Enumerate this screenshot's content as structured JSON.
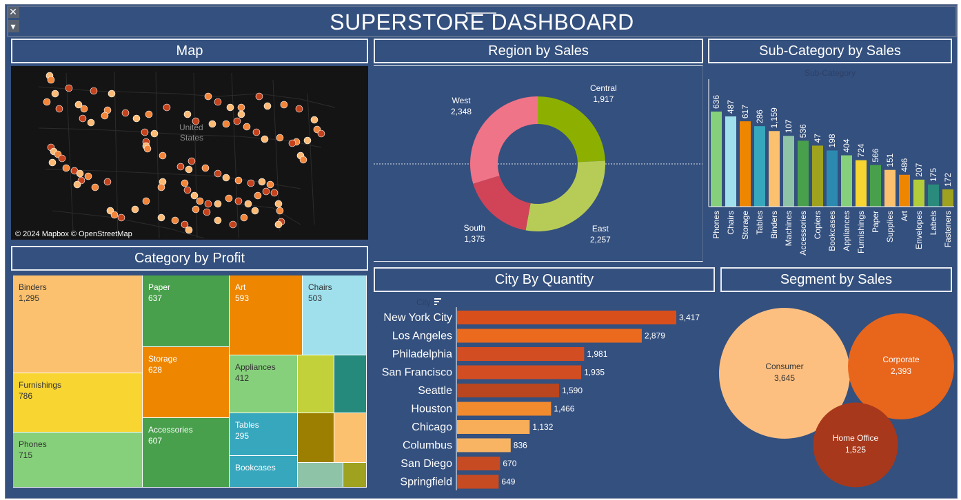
{
  "window": {
    "close_glyph": "✕",
    "menu_glyph": "▾"
  },
  "dashboard_title": "SUPERSTORE DASHBOARD",
  "map": {
    "title": "Map",
    "country_label_line1": "United",
    "country_label_line2": "States",
    "attribution": "© 2024 Mapbox © OpenStreetMap",
    "colors": {
      "background": "#141414",
      "point_light": "#fdba74",
      "point_mid": "#f2853a",
      "point_dark": "#c4421c"
    }
  },
  "region": {
    "title": "Region by Sales",
    "slices": [
      {
        "name": "Central",
        "value": "1,917",
        "num": 1917,
        "color": "#8db000"
      },
      {
        "name": "East",
        "value": "2,257",
        "num": 2257,
        "color": "#b7cc57"
      },
      {
        "name": "South",
        "value": "1,375",
        "num": 1375,
        "color": "#d14458"
      },
      {
        "name": "West",
        "value": "2,348",
        "num": 2348,
        "color": "#ef7487"
      }
    ]
  },
  "subcategory": {
    "title": "Sub-Category by Sales",
    "axis_header": "Sub-Category",
    "bars": [
      {
        "name": "Phones",
        "value": "636",
        "num": 636,
        "color": "#86d07b"
      },
      {
        "name": "Chairs",
        "value": "487",
        "num": 487,
        "color": "#9fe0ec"
      },
      {
        "name": "Storage",
        "value": "617",
        "num": 617,
        "color": "#ee8600"
      },
      {
        "name": "Tables",
        "value": "286",
        "num": 286,
        "color": "#37a7be"
      },
      {
        "name": "Binders",
        "value": "1,159",
        "num": 1159,
        "color": "#fcc16e"
      },
      {
        "name": "Machines",
        "value": "107",
        "num": 107,
        "color": "#8fc3a8"
      },
      {
        "name": "Accessories",
        "value": "536",
        "num": 536,
        "color": "#49a04c"
      },
      {
        "name": "Copiers",
        "value": "47",
        "num": 47,
        "color": "#9ea21e"
      },
      {
        "name": "Bookcases",
        "value": "198",
        "num": 198,
        "color": "#2c8ab1"
      },
      {
        "name": "Appliances",
        "value": "404",
        "num": 404,
        "color": "#86d07b"
      },
      {
        "name": "Furnishings",
        "value": "724",
        "num": 724,
        "color": "#f8d531"
      },
      {
        "name": "Paper",
        "value": "566",
        "num": 566,
        "color": "#49a04c"
      },
      {
        "name": "Supplies",
        "value": "151",
        "num": 151,
        "color": "#fcc16e"
      },
      {
        "name": "Art",
        "value": "486",
        "num": 486,
        "color": "#ee8600"
      },
      {
        "name": "Envelopes",
        "value": "207",
        "num": 207,
        "color": "#b3cc3a"
      },
      {
        "name": "Labels",
        "value": "175",
        "num": 175,
        "color": "#2a8a7c"
      },
      {
        "name": "Fasteners",
        "value": "172",
        "num": 172,
        "color": "#9ea21e"
      }
    ]
  },
  "category": {
    "title": "Category by Profit",
    "tiles": [
      {
        "name": "Binders",
        "value": "1,295",
        "color": "#fcc16e"
      },
      {
        "name": "Furnishings",
        "value": "786",
        "color": "#f8d531"
      },
      {
        "name": "Phones",
        "value": "715",
        "color": "#86d07b"
      },
      {
        "name": "Paper",
        "value": "637",
        "color": "#49a04c"
      },
      {
        "name": "Storage",
        "value": "628",
        "color": "#ee8600"
      },
      {
        "name": "Accessories",
        "value": "607",
        "color": "#49a04c"
      },
      {
        "name": "Art",
        "value": "593",
        "color": "#ee8600"
      },
      {
        "name": "Chairs",
        "value": "503",
        "color": "#9fe0ec"
      },
      {
        "name": "Appliances",
        "value": "412",
        "color": "#86d07b"
      },
      {
        "name": "Tables",
        "value": "295",
        "color": "#37a7be"
      },
      {
        "name": "Bookcases",
        "value": "",
        "color": "#37a7be"
      }
    ],
    "unlabeled_tile_colors": [
      "#c2d13a",
      "#258a7b",
      "#9c7f00",
      "#fcc16e",
      "#8fc3a8",
      "#9ea21e"
    ]
  },
  "city": {
    "title": "City By Quantity",
    "axis_header": "City",
    "sort_icon": "sort-icon",
    "bars": [
      {
        "name": "New York City",
        "value": "3,417",
        "num": 3417,
        "color": "#d84f1c"
      },
      {
        "name": "Los Angeles",
        "value": "2,879",
        "num": 2879,
        "color": "#eb6a1e"
      },
      {
        "name": "Philadelphia",
        "value": "1,981",
        "num": 1981,
        "color": "#d24d22"
      },
      {
        "name": "San Francisco",
        "value": "1,935",
        "num": 1935,
        "color": "#d24d22"
      },
      {
        "name": "Seattle",
        "value": "1,590",
        "num": 1590,
        "color": "#b9461e"
      },
      {
        "name": "Houston",
        "value": "1,466",
        "num": 1466,
        "color": "#f28a2e"
      },
      {
        "name": "Chicago",
        "value": "1,132",
        "num": 1132,
        "color": "#f8ad58"
      },
      {
        "name": "Columbus",
        "value": "836",
        "num": 836,
        "color": "#f9b463"
      },
      {
        "name": "San Diego",
        "value": "670",
        "num": 670,
        "color": "#c64a22"
      },
      {
        "name": "Springfield",
        "value": "649",
        "num": 649,
        "color": "#c64a22"
      }
    ]
  },
  "segment": {
    "title": "Segment by Sales",
    "bubbles": [
      {
        "name": "Consumer",
        "value": "3,645",
        "num": 3645,
        "color": "#fdbf80",
        "text_color": "#333333"
      },
      {
        "name": "Corporate",
        "value": "2,393",
        "num": 2393,
        "color": "#e8651c",
        "text_color": "#ffffff"
      },
      {
        "name": "Home Office",
        "value": "1,525",
        "num": 1525,
        "color": "#a8381b",
        "text_color": "#ffffff"
      }
    ]
  }
}
